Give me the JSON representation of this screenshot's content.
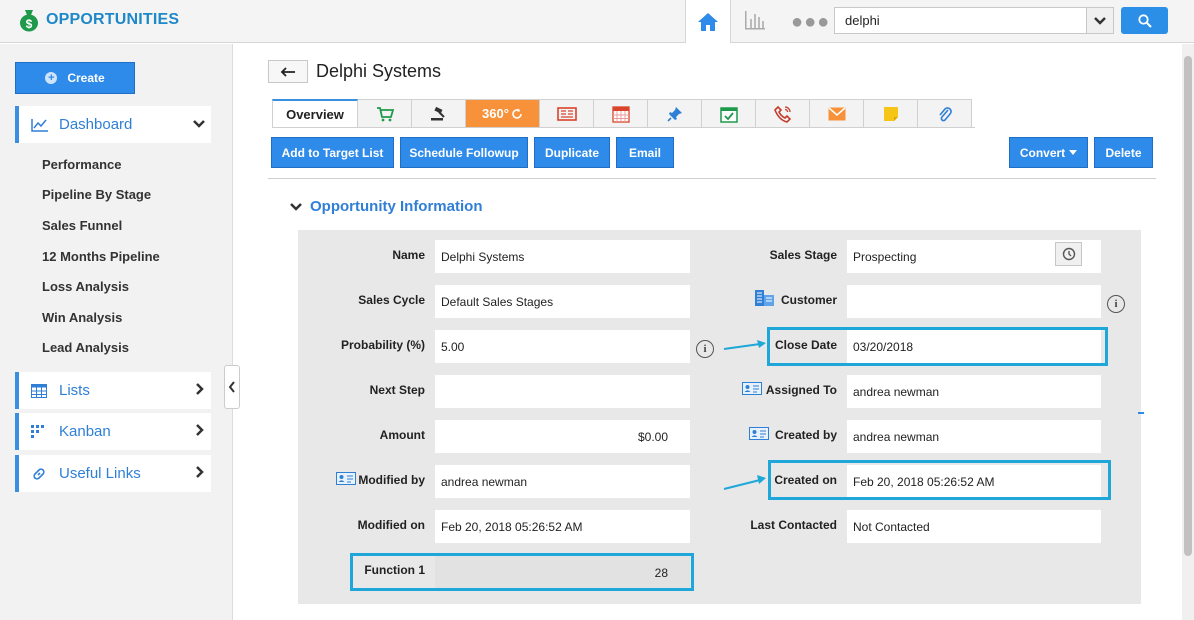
{
  "app": {
    "title": "OPPORTUNITIES"
  },
  "search": {
    "value": "delphi"
  },
  "sidebar": {
    "create_label": "Create",
    "dashboard_label": "Dashboard",
    "dashboard_items": [
      "Performance",
      "Pipeline By Stage",
      "Sales Funnel",
      "12 Months Pipeline",
      "Loss Analysis",
      "Win Analysis",
      "Lead Analysis"
    ],
    "lists_label": "Lists",
    "kanban_label": "Kanban",
    "useful_links_label": "Useful Links"
  },
  "record": {
    "title": "Delphi Systems"
  },
  "tabs": {
    "overview": "Overview",
    "t360": "360°"
  },
  "actions": {
    "add_to_target_list": "Add to Target List",
    "schedule_followup": "Schedule Followup",
    "duplicate": "Duplicate",
    "email": "Email",
    "convert": "Convert",
    "delete": "Delete"
  },
  "section": {
    "title": "Opportunity Information"
  },
  "fields": {
    "name": {
      "label": "Name",
      "value": "Delphi Systems"
    },
    "sales_cycle": {
      "label": "Sales Cycle",
      "value": "Default Sales Stages"
    },
    "probability": {
      "label": "Probability (%)",
      "value": "5.00"
    },
    "next_step": {
      "label": "Next Step",
      "value": ""
    },
    "amount": {
      "label": "Amount",
      "value": "$0.00"
    },
    "modified_by": {
      "label": "Modified by",
      "value": "andrea newman"
    },
    "modified_on": {
      "label": "Modified on",
      "value": "Feb 20, 2018 05:26:52 AM"
    },
    "function_1": {
      "label": "Function 1",
      "value": "28"
    },
    "sales_stage": {
      "label": "Sales Stage",
      "value": "Prospecting"
    },
    "customer": {
      "label": "Customer",
      "value": ""
    },
    "close_date": {
      "label": "Close Date",
      "value": "03/20/2018"
    },
    "assigned_to": {
      "label": "Assigned To",
      "value": "andrea newman"
    },
    "created_by": {
      "label": "Created by",
      "value": "andrea newman"
    },
    "created_on": {
      "label": "Created on",
      "value": "Feb 20, 2018 05:26:52 AM"
    },
    "last_contacted": {
      "label": "Last Contacted",
      "value": "Not Contacted"
    }
  },
  "colors": {
    "accent": "#2f8bea",
    "brand": "#1e88c8",
    "highlight": "#1ea7d8",
    "tab_360": "#f7923a"
  }
}
